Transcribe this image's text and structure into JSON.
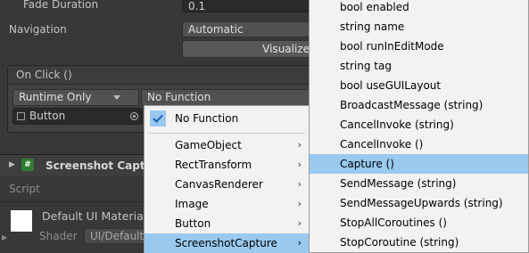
{
  "inspector": {
    "fade_duration_label": "Fade Duration",
    "fade_duration_value": "0.1",
    "navigation_label": "Navigation",
    "navigation_value": "Automatic",
    "visualize_label": "Visualize",
    "on_click_label": "On Click ()",
    "runtime_dropdown": "Runtime Only",
    "function_dropdown": "No Function",
    "target_object": "Button",
    "component_title": "Screenshot Capture",
    "script_label": "Script",
    "material_name": "Default UI Material",
    "shader_label": "Shader",
    "shader_value": "UI/Default"
  },
  "menu1": {
    "checked_item": "No Function",
    "items": [
      "GameObject",
      "RectTransform",
      "CanvasRenderer",
      "Image",
      "Button",
      "ScreenshotCapture"
    ],
    "highlighted": "ScreenshotCapture"
  },
  "menu2": {
    "items": [
      "bool enabled",
      "string name",
      "bool runInEditMode",
      "string tag",
      "bool useGUILayout",
      "BroadcastMessage (string)",
      "CancelInvoke (string)",
      "CancelInvoke ()",
      "Capture ()",
      "SendMessage (string)",
      "SendMessageUpwards (string)",
      "StopAllCoroutines ()",
      "StopCoroutine (string)"
    ],
    "highlighted": "Capture ()"
  },
  "colors": {
    "panel_bg": "#383838",
    "menu_bg": "#f2f2f2",
    "highlight": "#99c9ef",
    "checkmark": "#1a5fb4"
  },
  "icons": {
    "checkmark": "check-icon",
    "submenu": "chevron-right-icon",
    "target": "object-picker-icon",
    "cube": "gameobject-icon",
    "script": "csharp-script-icon",
    "material": "material-swatch-icon"
  }
}
